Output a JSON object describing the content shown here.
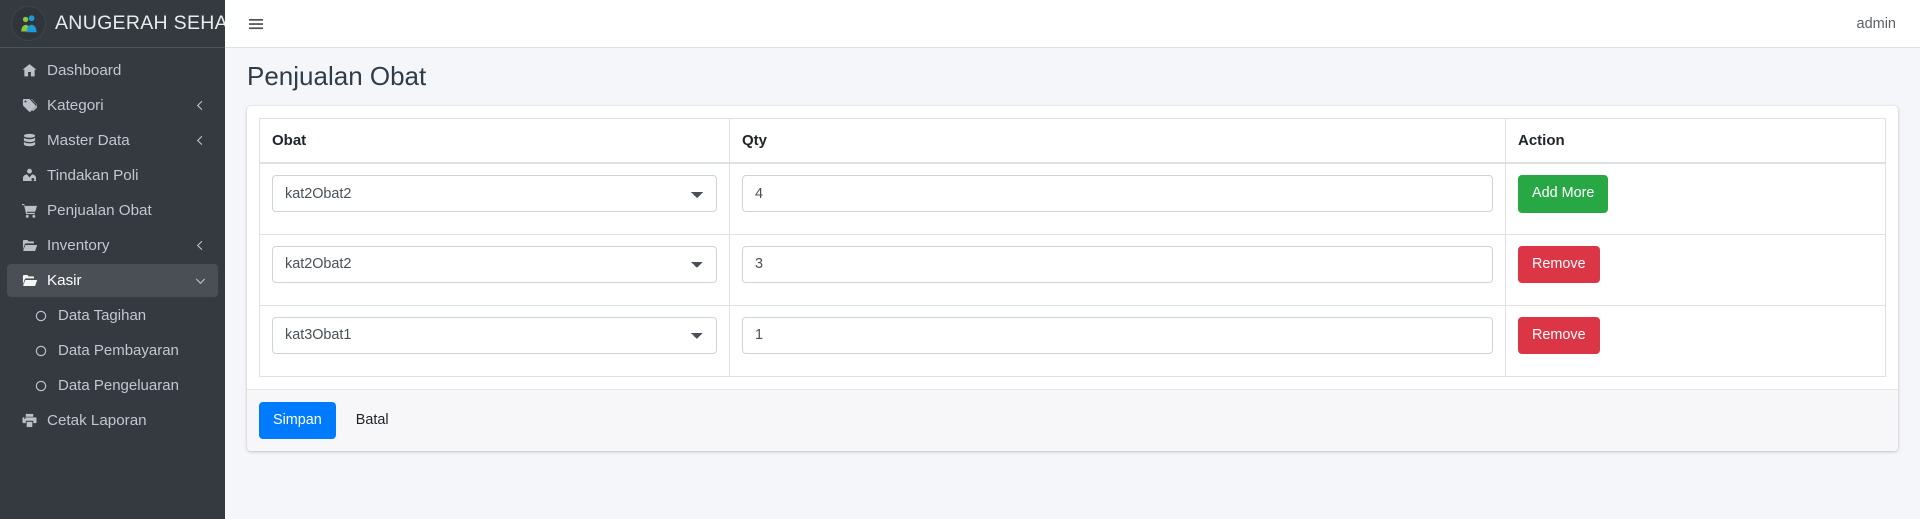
{
  "brand": {
    "name": "ANUGERAH SEHAT",
    "logo_icon": "people-logo-icon"
  },
  "sidebar": {
    "items": [
      {
        "label": "Dashboard",
        "icon": "home-icon",
        "chevron": "",
        "active": false,
        "sub": false
      },
      {
        "label": "Kategori",
        "icon": "tag-icon",
        "chevron": "left",
        "active": false,
        "sub": false
      },
      {
        "label": "Master Data",
        "icon": "database-icon",
        "chevron": "left",
        "active": false,
        "sub": false
      },
      {
        "label": "Tindakan Poli",
        "icon": "user-md-icon",
        "chevron": "",
        "active": false,
        "sub": false
      },
      {
        "label": "Penjualan Obat",
        "icon": "cart-icon",
        "chevron": "",
        "active": false,
        "sub": false
      },
      {
        "label": "Inventory",
        "icon": "folder-open-icon",
        "chevron": "left",
        "active": false,
        "sub": false
      },
      {
        "label": "Kasir",
        "icon": "folder-open-icon",
        "chevron": "down",
        "active": true,
        "sub": false
      },
      {
        "label": "Data Tagihan",
        "icon": "circle-icon",
        "chevron": "",
        "active": false,
        "sub": true
      },
      {
        "label": "Data Pembayaran",
        "icon": "circle-icon",
        "chevron": "",
        "active": false,
        "sub": true
      },
      {
        "label": "Data Pengeluaran",
        "icon": "circle-icon",
        "chevron": "",
        "active": false,
        "sub": true
      },
      {
        "label": "Cetak Laporan",
        "icon": "print-icon",
        "chevron": "",
        "active": false,
        "sub": false
      }
    ]
  },
  "topbar": {
    "menu_icon": "hamburger-icon",
    "user_label": "admin"
  },
  "page": {
    "title": "Penjualan Obat"
  },
  "table": {
    "headers": {
      "obat": "Obat",
      "qty": "Qty",
      "action": "Action"
    },
    "rows": [
      {
        "obat": "kat2Obat2",
        "qty": "4",
        "action_label": "Add More",
        "action_style": "success"
      },
      {
        "obat": "kat2Obat2",
        "qty": "3",
        "action_label": "Remove",
        "action_style": "danger"
      },
      {
        "obat": "kat3Obat1",
        "qty": "1",
        "action_label": "Remove",
        "action_style": "danger"
      }
    ],
    "obat_options": [
      "kat2Obat2",
      "kat3Obat1"
    ]
  },
  "footer": {
    "save_label": "Simpan",
    "cancel_label": "Batal"
  },
  "colors": {
    "sidebar_bg": "#343a40",
    "primary": "#007bff",
    "success": "#28a745",
    "danger": "#dc3545",
    "page_bg": "#f4f6f9"
  }
}
